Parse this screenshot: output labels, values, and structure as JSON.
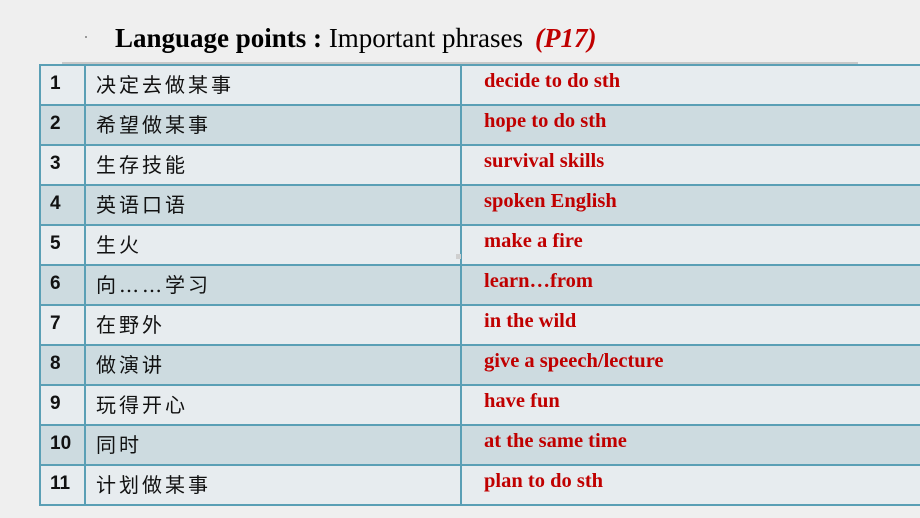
{
  "title": {
    "bold_part": "Language points :",
    "normal_part": " Important phrases",
    "page_ref": "(P17)"
  },
  "colors": {
    "accent_red": "#c00000",
    "border_teal": "#5a9fb5",
    "row_light": "#e7ecef",
    "row_dark": "#cddbe0"
  },
  "rows": [
    {
      "num": "1",
      "chinese": "决定去做某事",
      "english": "decide to do sth"
    },
    {
      "num": "2",
      "chinese": "希望做某事",
      "english": "hope to do sth"
    },
    {
      "num": "3",
      "chinese": "生存技能",
      "english": "survival skills"
    },
    {
      "num": "4",
      "chinese": "英语口语",
      "english": "spoken English"
    },
    {
      "num": "5",
      "chinese": "生火",
      "english": "make a fire"
    },
    {
      "num": "6",
      "chinese": "向……学习",
      "english": "learn…from"
    },
    {
      "num": "7",
      "chinese": "在野外",
      "english": "in the wild"
    },
    {
      "num": "8",
      "chinese": "做演讲",
      "english": "give a speech/lecture"
    },
    {
      "num": "9",
      "chinese": "玩得开心",
      "english": "have fun"
    },
    {
      "num": "10",
      "chinese": "同时",
      "english": "at the same time"
    },
    {
      "num": "11",
      "chinese": "计划做某事",
      "english": "plan to do sth"
    }
  ]
}
